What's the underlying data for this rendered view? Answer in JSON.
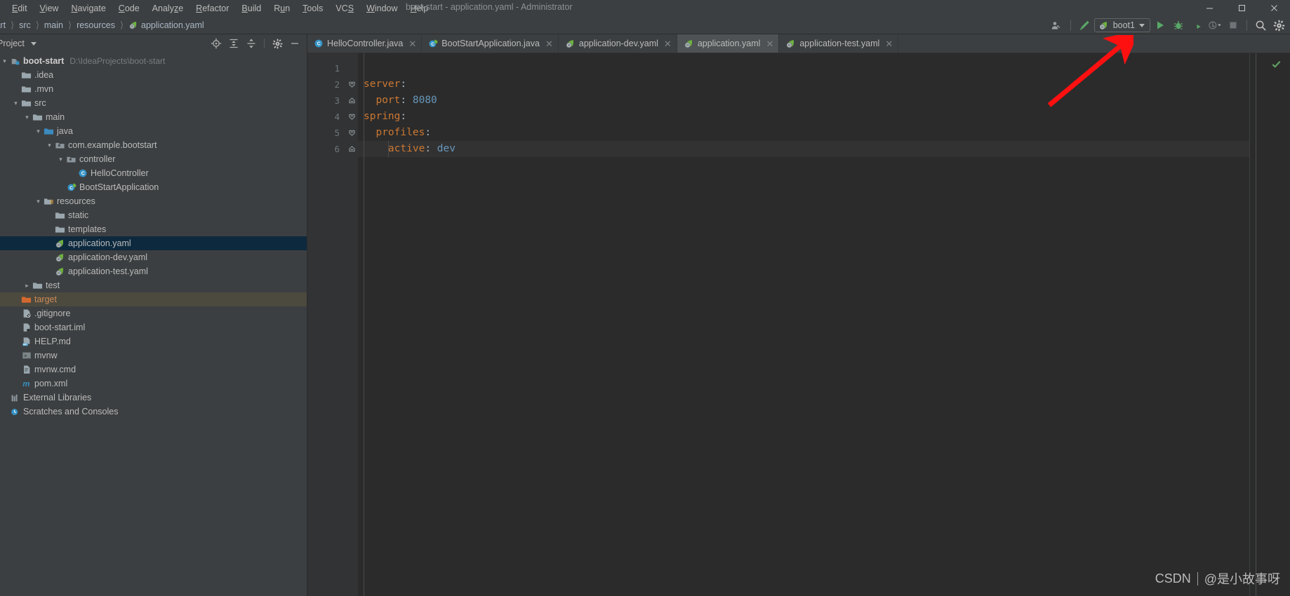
{
  "window": {
    "title": "boot-start - application.yaml - Administrator",
    "controls": {
      "minimize": "—",
      "maximize": "☐",
      "close": "✕"
    }
  },
  "menubar": {
    "items": [
      {
        "label": "Edit",
        "mnemonic": "E"
      },
      {
        "label": "View",
        "mnemonic": "V"
      },
      {
        "label": "Navigate",
        "mnemonic": "N"
      },
      {
        "label": "Code",
        "mnemonic": "C"
      },
      {
        "label": "Analyze",
        "mnemonic": "z"
      },
      {
        "label": "Refactor",
        "mnemonic": "R"
      },
      {
        "label": "Build",
        "mnemonic": "B"
      },
      {
        "label": "Run",
        "mnemonic": "u"
      },
      {
        "label": "Tools",
        "mnemonic": "T"
      },
      {
        "label": "VCS",
        "mnemonic": "S"
      },
      {
        "label": "Window",
        "mnemonic": "W"
      },
      {
        "label": "Help",
        "mnemonic": "H"
      }
    ]
  },
  "navbar": {
    "breadcrumbs": [
      "tart",
      "src",
      "main",
      "resources",
      "application.yaml"
    ],
    "separator": "〉",
    "toolbar": {
      "profile_icon": "user-profile-icon",
      "build_icon": "build-hammer-icon",
      "run_config": "boot1",
      "run_icon": "run-play-icon",
      "debug_icon": "debug-bug-icon",
      "run_coverage_icon": "run-with-coverage-icon",
      "profiler_icon": "profiler-icon",
      "stop_icon": "stop-icon",
      "search_icon": "search-everywhere-icon",
      "settings_icon": "settings-gear-icon"
    }
  },
  "project_panel": {
    "title": "Project",
    "tools": {
      "locate": "locate-target-icon",
      "expand_all": "expand-all-icon",
      "collapse_all": "collapse-all-icon",
      "settings": "gear-icon",
      "hide": "minimize-icon"
    },
    "tree": [
      {
        "label": "boot-start",
        "path": "D:\\IdeaProjects\\boot-start",
        "depth": 0,
        "arrow": "down",
        "icon": "project-module-icon",
        "bold": true,
        "state": "normal"
      },
      {
        "label": ".idea",
        "depth": 1,
        "arrow": "none",
        "icon": "folder-icon",
        "state": "normal"
      },
      {
        "label": ".mvn",
        "depth": 1,
        "arrow": "none",
        "icon": "folder-icon",
        "state": "normal"
      },
      {
        "label": "src",
        "depth": 1,
        "arrow": "down",
        "icon": "folder-icon",
        "state": "normal"
      },
      {
        "label": "main",
        "depth": 2,
        "arrow": "down",
        "icon": "folder-icon",
        "state": "normal"
      },
      {
        "label": "java",
        "depth": 3,
        "arrow": "down",
        "icon": "source-root-icon",
        "state": "normal"
      },
      {
        "label": "com.example.bootstart",
        "depth": 4,
        "arrow": "down",
        "icon": "package-icon",
        "state": "normal"
      },
      {
        "label": "controller",
        "depth": 5,
        "arrow": "down",
        "icon": "package-icon",
        "state": "normal"
      },
      {
        "label": "HelloController",
        "depth": 6,
        "arrow": "none",
        "icon": "java-class-icon",
        "state": "normal"
      },
      {
        "label": "BootStartApplication",
        "depth": 5,
        "arrow": "none",
        "icon": "spring-boot-class-icon",
        "state": "normal"
      },
      {
        "label": "resources",
        "depth": 3,
        "arrow": "down",
        "icon": "resources-root-icon",
        "state": "normal"
      },
      {
        "label": "static",
        "depth": 4,
        "arrow": "none",
        "icon": "folder-icon",
        "state": "normal"
      },
      {
        "label": "templates",
        "depth": 4,
        "arrow": "none",
        "icon": "folder-icon",
        "state": "normal"
      },
      {
        "label": "application.yaml",
        "depth": 4,
        "arrow": "none",
        "icon": "spring-yaml-icon",
        "state": "selected"
      },
      {
        "label": "application-dev.yaml",
        "depth": 4,
        "arrow": "none",
        "icon": "spring-yaml-icon",
        "state": "normal"
      },
      {
        "label": "application-test.yaml",
        "depth": 4,
        "arrow": "none",
        "icon": "spring-yaml-icon",
        "state": "normal"
      },
      {
        "label": "test",
        "depth": 2,
        "arrow": "right",
        "icon": "folder-icon",
        "state": "normal"
      },
      {
        "label": "target",
        "depth": 1,
        "arrow": "none",
        "icon": "excluded-folder-icon",
        "state": "excluded"
      },
      {
        "label": ".gitignore",
        "depth": 1,
        "arrow": "none",
        "icon": "gitignore-file-icon",
        "state": "normal"
      },
      {
        "label": "boot-start.iml",
        "depth": 1,
        "arrow": "none",
        "icon": "iml-file-icon",
        "state": "normal"
      },
      {
        "label": "HELP.md",
        "depth": 1,
        "arrow": "none",
        "icon": "markdown-file-icon",
        "state": "normal"
      },
      {
        "label": "mvnw",
        "depth": 1,
        "arrow": "none",
        "icon": "shell-script-icon",
        "state": "normal"
      },
      {
        "label": "mvnw.cmd",
        "depth": 1,
        "arrow": "none",
        "icon": "cmd-file-icon",
        "state": "normal"
      },
      {
        "label": "pom.xml",
        "depth": 1,
        "arrow": "none",
        "icon": "maven-pom-icon",
        "state": "normal"
      },
      {
        "label": "External Libraries",
        "depth": 0,
        "arrow": "none",
        "icon": "libraries-icon",
        "state": "normal"
      },
      {
        "label": "Scratches and Consoles",
        "depth": 0,
        "arrow": "none",
        "icon": "scratches-icon",
        "state": "normal"
      }
    ]
  },
  "editor": {
    "tabs": [
      {
        "label": "HelloController.java",
        "icon": "java-class-icon",
        "active": false
      },
      {
        "label": "BootStartApplication.java",
        "icon": "spring-boot-class-icon",
        "active": false
      },
      {
        "label": "application-dev.yaml",
        "icon": "spring-yaml-icon",
        "active": false
      },
      {
        "label": "application.yaml",
        "icon": "spring-yaml-icon",
        "active": true
      },
      {
        "label": "application-test.yaml",
        "icon": "spring-yaml-icon",
        "active": false
      }
    ],
    "close_glyph": "✕",
    "line_numbers": [
      "1",
      "2",
      "3",
      "4",
      "5",
      "6"
    ],
    "lines": [
      {
        "num": "1",
        "indent": 0,
        "key": "",
        "sep": "",
        "value": "",
        "fold": "none",
        "caret": false
      },
      {
        "num": "2",
        "indent": 0,
        "key": "server",
        "sep": ":",
        "value": "",
        "fold": "open",
        "caret": false
      },
      {
        "num": "3",
        "indent": 1,
        "key": "port",
        "sep": ":",
        "value": "8080",
        "fold": "end",
        "caret": false
      },
      {
        "num": "4",
        "indent": 0,
        "key": "spring",
        "sep": ":",
        "value": "",
        "fold": "open",
        "caret": false
      },
      {
        "num": "5",
        "indent": 1,
        "key": "profiles",
        "sep": ":",
        "value": "",
        "fold": "open",
        "caret": false
      },
      {
        "num": "6",
        "indent": 2,
        "key": "active",
        "sep": ":",
        "value": "dev",
        "fold": "end",
        "caret": true
      }
    ],
    "inspection_status": "ok-check-icon",
    "colors": {
      "key": "#cc7832",
      "value": "#6897bb",
      "punct": "#a9b7c6",
      "background": "#2b2b2b"
    }
  },
  "annotation": {
    "arrow": {
      "color": "#ff0000",
      "points_to": "run-configuration-boot1"
    }
  },
  "watermark": {
    "brand": "CSDN",
    "author": "@是小故事呀"
  }
}
